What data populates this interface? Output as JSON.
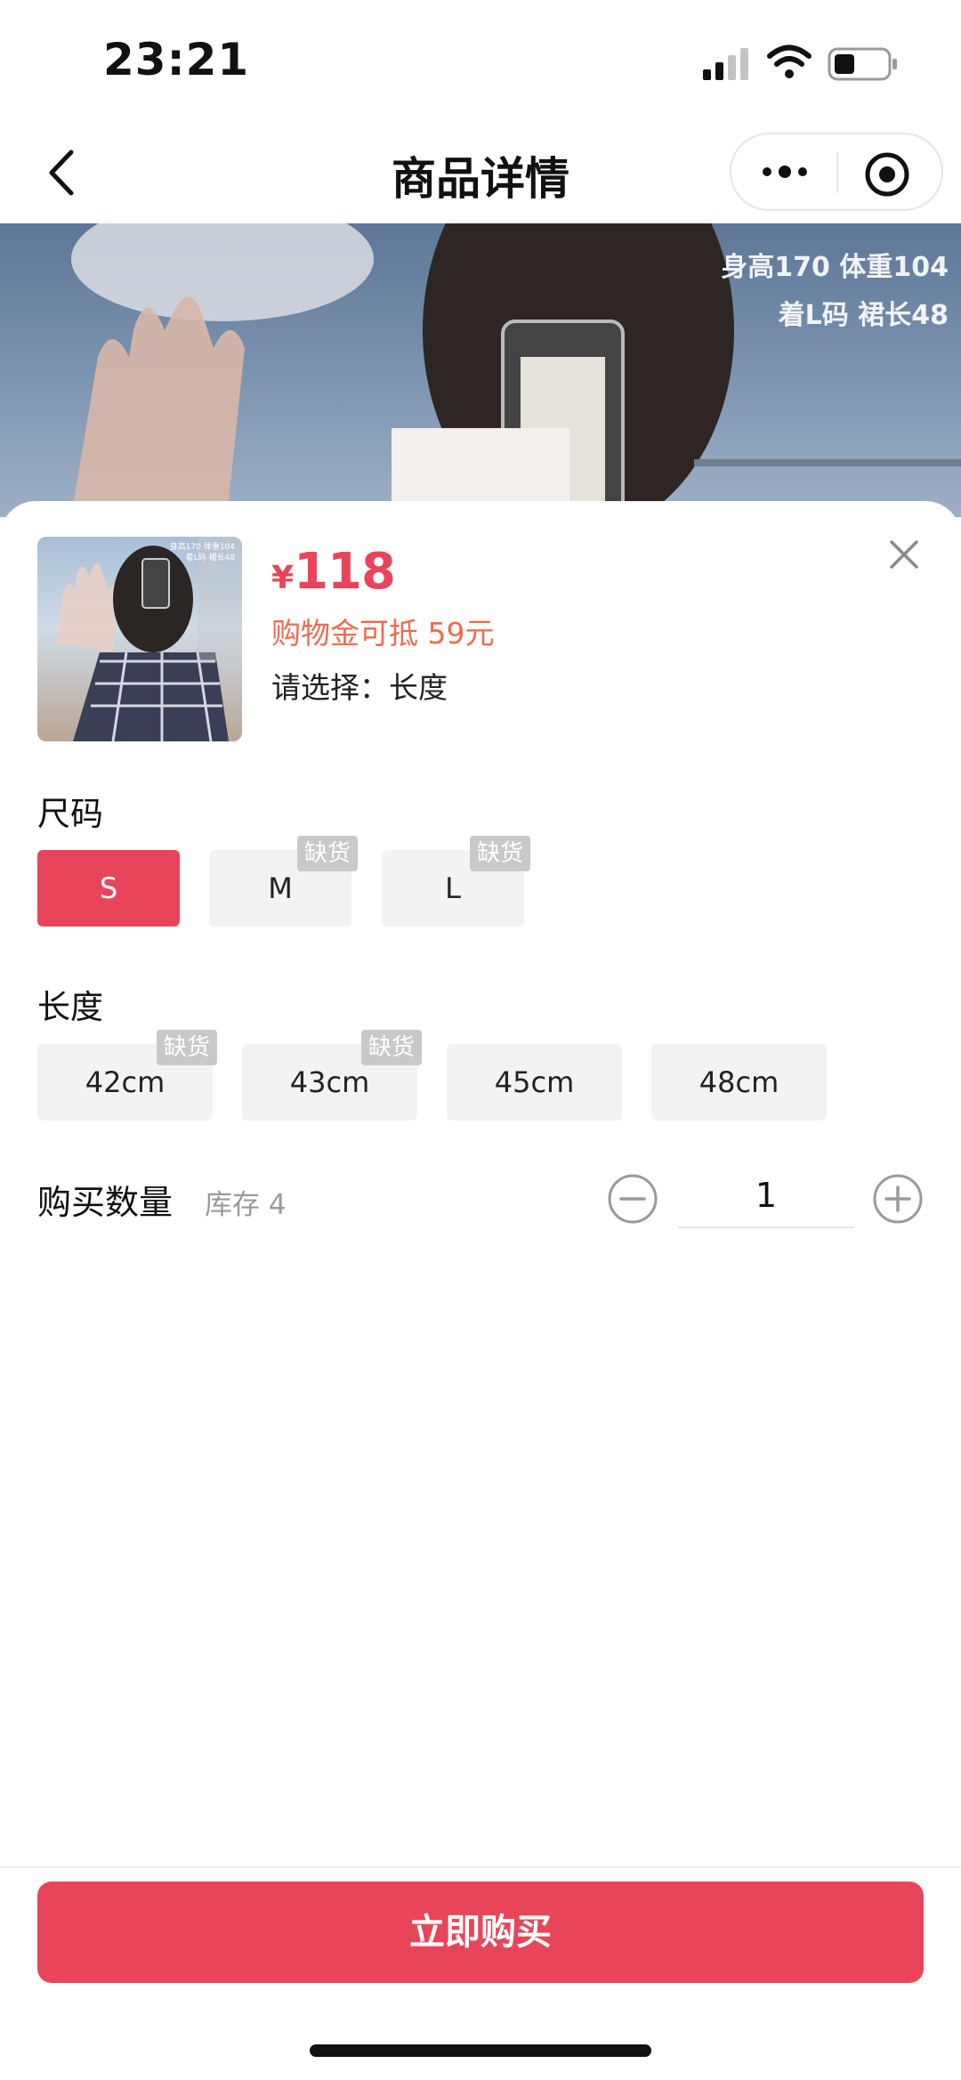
{
  "status_bar": {
    "time": "23:21"
  },
  "nav": {
    "title": "商品详情",
    "back_icon": "chevron-left-icon",
    "more_icon": "more-dots-icon",
    "target_icon": "target-icon"
  },
  "banner": {
    "caption_line1": "身高170 体重104",
    "caption_line2": "着L码 裙长48"
  },
  "product": {
    "price_symbol": "¥",
    "price": "118",
    "voucher": "购物金可抵 59元",
    "select_hint": "请选择：长度",
    "thumb_caption_line1": "身高170 体重104",
    "thumb_caption_line2": "着L码 裙长48"
  },
  "size": {
    "label": "尺码",
    "options": [
      {
        "label": "S",
        "selected": true,
        "badge": ""
      },
      {
        "label": "M",
        "selected": false,
        "badge": "缺货"
      },
      {
        "label": "L",
        "selected": false,
        "badge": "缺货"
      }
    ]
  },
  "length": {
    "label": "长度",
    "options": [
      {
        "label": "42cm",
        "badge": "缺货"
      },
      {
        "label": "43cm",
        "badge": "缺货"
      },
      {
        "label": "45cm",
        "badge": ""
      },
      {
        "label": "48cm",
        "badge": ""
      }
    ]
  },
  "quantity": {
    "label": "购买数量",
    "stock": "库存 4",
    "value": "1"
  },
  "footer": {
    "buy_label": "立即购买"
  },
  "colors": {
    "accent": "#e8455b",
    "voucher": "#ef6b4d",
    "chip_bg": "#f3f3f3",
    "badge_bg": "#c9c9c9"
  }
}
